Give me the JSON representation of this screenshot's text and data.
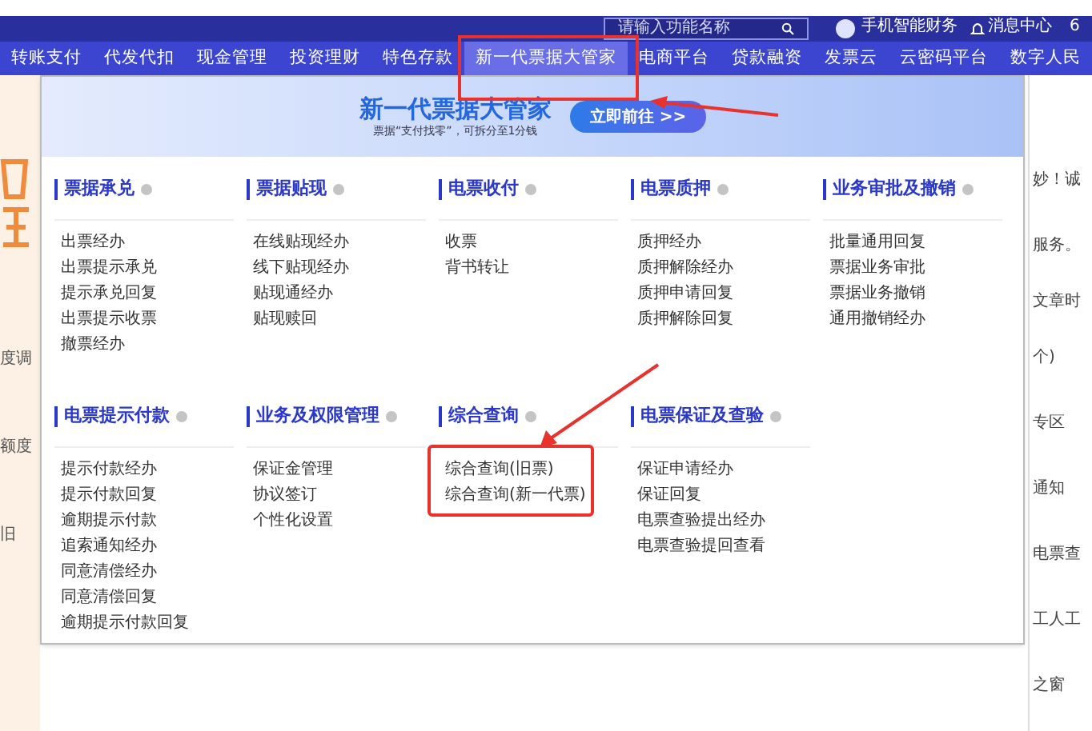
{
  "top_bar": {
    "search_placeholder": "请输入功能名称",
    "user": "手机智能财务",
    "messages": "消息中心",
    "extra": "6"
  },
  "nav": [
    {
      "label": "转账支付",
      "selected": false
    },
    {
      "label": "代发代扣",
      "selected": false
    },
    {
      "label": "现金管理",
      "selected": false
    },
    {
      "label": "投资理财",
      "selected": false
    },
    {
      "label": "特色存款",
      "selected": false
    },
    {
      "label": "新一代票据大管家",
      "selected": true
    },
    {
      "label": "电商平台",
      "selected": false
    },
    {
      "label": "贷款融资",
      "selected": false
    },
    {
      "label": "发票云",
      "selected": false
    },
    {
      "label": "云密码平台",
      "selected": false
    },
    {
      "label": "数字人民",
      "selected": false
    }
  ],
  "banner": {
    "title": "新一代票据大管家",
    "subtitle": "票据“支付找零”，可拆分至1分钱",
    "button": "立即前往 >>"
  },
  "sections": [
    {
      "title": "票据承兑",
      "items": [
        "出票经办",
        "出票提示承兑",
        "提示承兑回复",
        "出票提示收票",
        "撤票经办"
      ]
    },
    {
      "title": "票据贴现",
      "items": [
        "在线贴现经办",
        "线下贴现经办",
        "贴现通经办",
        "贴现赎回"
      ]
    },
    {
      "title": "电票收付",
      "items": [
        "收票",
        "背书转让"
      ]
    },
    {
      "title": "电票质押",
      "items": [
        "质押经办",
        "质押解除经办",
        "质押申请回复",
        "质押解除回复"
      ]
    },
    {
      "title": "业务审批及撤销",
      "items": [
        "批量通用回复",
        "票据业务审批",
        "票据业务撤销",
        "通用撤销经办"
      ]
    },
    {
      "title": "电票提示付款",
      "items": [
        "提示付款经办",
        "提示付款回复",
        "逾期提示付款",
        "追索通知经办",
        "同意清偿经办",
        "同意清偿回复",
        "逾期提示付款回复"
      ]
    },
    {
      "title": "业务及权限管理",
      "items": [
        "保证金管理",
        "协议签订",
        "个性化设置"
      ]
    },
    {
      "title": "综合查询",
      "items": [
        "综合查询(旧票)",
        "综合查询(新一代票)"
      ]
    },
    {
      "title": "电票保证及查验",
      "items": [
        "保证申请经办",
        "保证回复",
        "电票查验提出经办",
        "电票查验提回查看"
      ]
    }
  ],
  "left_panel": {
    "texts": [
      "度调",
      "额度",
      "旧"
    ]
  },
  "right_panel": {
    "texts": [
      "妙！诚",
      "服务。",
      "文章时",
      "个)",
      "专区",
      "通知",
      "电票查",
      "工人工",
      "之窗"
    ]
  }
}
